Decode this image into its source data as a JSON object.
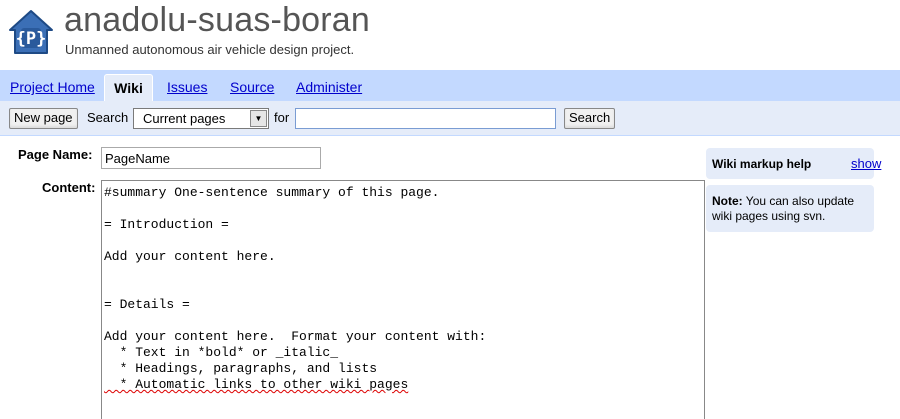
{
  "header": {
    "project_name": "anadolu-suas-boran",
    "project_summary": "Unmanned autonomous air vehicle design project.",
    "logo_letter": "{P}",
    "logo_icon": "project-house-icon"
  },
  "tabs": [
    {
      "label": "Project Home",
      "active": false
    },
    {
      "label": "Wiki",
      "active": true
    },
    {
      "label": "Issues",
      "active": false
    },
    {
      "label": "Source",
      "active": false
    },
    {
      "label": "Administer",
      "active": false
    }
  ],
  "toolbar": {
    "new_page_label": "New page",
    "search_label": "Search",
    "scope_value": "Current pages",
    "for_label": "for",
    "search_query": "",
    "search_button_label": "Search"
  },
  "form": {
    "page_name_label": "Page Name:",
    "page_name_value": "PageName",
    "content_label": "Content:",
    "content_lines": [
      "#summary One-sentence summary of this page.",
      "",
      "= Introduction =",
      "",
      "Add your content here.",
      "",
      "",
      "= Details =",
      "",
      "Add your content here.  Format your content with:",
      "  * Text in *bold* or _italic_",
      "  * Headings, paragraphs, and lists",
      "  * Automatic links to other wiki pages"
    ]
  },
  "sidebar": {
    "markup_help_title": "Wiki markup help",
    "markup_help_toggle": "show",
    "note_label": "Note:",
    "note_text": " You can also update wiki pages using svn."
  },
  "colors": {
    "tab_bar": "#c3d9ff",
    "toolbar": "#e5ecf9",
    "link": "#0000cc",
    "logo_blue": "#2e5d9f"
  }
}
